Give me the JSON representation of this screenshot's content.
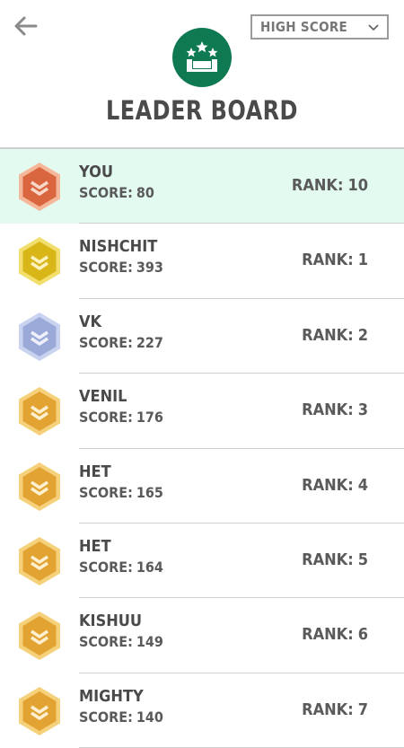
{
  "header": {
    "title": "LEADER BOARD",
    "filter_selected": "HIGH SCORE",
    "logo_color": "#0f7a52"
  },
  "labels": {
    "score": "SCORE:",
    "rank": "RANK:"
  },
  "rows": [
    {
      "name": "YOU",
      "score": "80",
      "rank": "10",
      "badge": "orange",
      "highlight": true
    },
    {
      "name": "NISHCHIT",
      "score": "393",
      "rank": "1",
      "badge": "gold"
    },
    {
      "name": "VK",
      "score": "227",
      "rank": "2",
      "badge": "silver"
    },
    {
      "name": "VENIL",
      "score": "176",
      "rank": "3",
      "badge": "amber"
    },
    {
      "name": "HET",
      "score": "165",
      "rank": "4",
      "badge": "amber"
    },
    {
      "name": "HET",
      "score": "164",
      "rank": "5",
      "badge": "amber"
    },
    {
      "name": "KISHUU",
      "score": "149",
      "rank": "6",
      "badge": "amber"
    },
    {
      "name": "MIGHTY",
      "score": "140",
      "rank": "7",
      "badge": "amber"
    }
  ],
  "badge_colors": {
    "orange": {
      "outer": "#f4b79a",
      "inner": "#d9663f",
      "chevron": "#f8d8c9"
    },
    "gold": {
      "outer": "#f1de6c",
      "inner": "#d8b617",
      "chevron": "#fbf2c0"
    },
    "silver": {
      "outer": "#c9d2ee",
      "inner": "#9ba9d9",
      "chevron": "#eef1fa"
    },
    "amber": {
      "outer": "#f6d17c",
      "inner": "#e2a332",
      "chevron": "#fdf0d0"
    }
  },
  "highlight_color": "#e3faf1"
}
